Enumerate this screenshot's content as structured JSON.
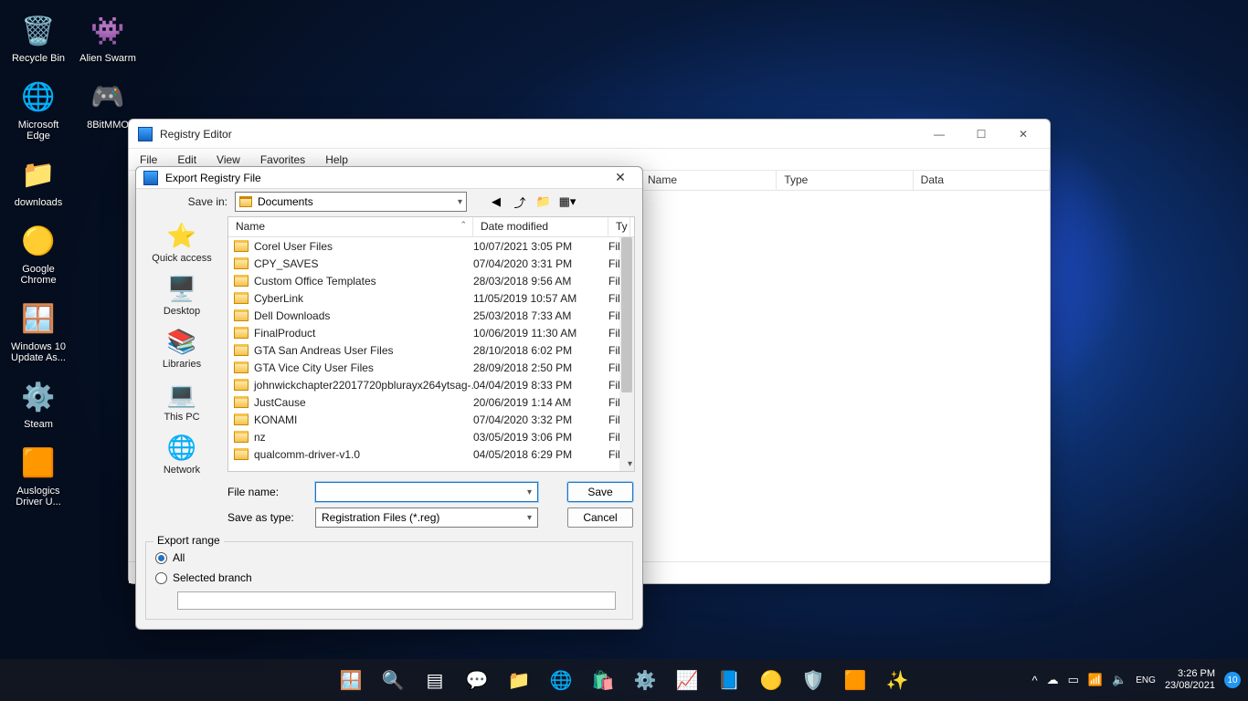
{
  "desktop_icons": [
    {
      "label": "Recycle Bin",
      "glyph": "🗑️"
    },
    {
      "label": "Alien Swarm",
      "glyph": "👾"
    },
    {
      "label": "Microsoft Edge",
      "glyph": "🌐"
    },
    {
      "label": "8BitMMO",
      "glyph": "🎮"
    },
    {
      "label": "downloads",
      "glyph": "📁"
    },
    {
      "label": "Google Chrome",
      "glyph": "🟡"
    },
    {
      "label": "Windows 10 Update As...",
      "glyph": "🪟"
    },
    {
      "label": "Steam",
      "glyph": "⚙️"
    },
    {
      "label": "Auslogics Driver U...",
      "glyph": "🟧"
    }
  ],
  "regedit": {
    "title": "Registry Editor",
    "menu": [
      "File",
      "Edit",
      "View",
      "Favorites",
      "Help"
    ],
    "right_cols": [
      "Name",
      "Type",
      "Data"
    ]
  },
  "dialog": {
    "title": "Export Registry File",
    "savein_label": "Save in:",
    "savein_value": "Documents",
    "places": [
      {
        "label": "Quick access",
        "glyph": "⭐"
      },
      {
        "label": "Desktop",
        "glyph": "🖥️"
      },
      {
        "label": "Libraries",
        "glyph": "📚"
      },
      {
        "label": "This PC",
        "glyph": "💻"
      },
      {
        "label": "Network",
        "glyph": "🌐"
      }
    ],
    "columns": {
      "name": "Name",
      "date": "Date modified",
      "type": "Ty"
    },
    "rows": [
      {
        "name": "Corel User Files",
        "date": "10/07/2021 3:05 PM",
        "type": "Fil"
      },
      {
        "name": "CPY_SAVES",
        "date": "07/04/2020 3:31 PM",
        "type": "Fil"
      },
      {
        "name": "Custom Office Templates",
        "date": "28/03/2018 9:56 AM",
        "type": "Fil"
      },
      {
        "name": "CyberLink",
        "date": "11/05/2019 10:57 AM",
        "type": "Fil"
      },
      {
        "name": "Dell Downloads",
        "date": "25/03/2018 7:33 AM",
        "type": "Fil"
      },
      {
        "name": "FinalProduct",
        "date": "10/06/2019 11:30 AM",
        "type": "Fil"
      },
      {
        "name": "GTA San Andreas User Files",
        "date": "28/10/2018 6:02 PM",
        "type": "Fil"
      },
      {
        "name": "GTA Vice City User Files",
        "date": "28/09/2018 2:50 PM",
        "type": "Fil"
      },
      {
        "name": "johnwickchapter22017720pblurayx264ytsag-...",
        "date": "04/04/2019 8:33 PM",
        "type": "Fil"
      },
      {
        "name": "JustCause",
        "date": "20/06/2019 1:14 AM",
        "type": "Fil"
      },
      {
        "name": "KONAMI",
        "date": "07/04/2020 3:32 PM",
        "type": "Fil"
      },
      {
        "name": "nz",
        "date": "03/05/2019 3:06 PM",
        "type": "Fil"
      },
      {
        "name": "qualcomm-driver-v1.0",
        "date": "04/05/2018 6:29 PM",
        "type": "Fil"
      }
    ],
    "filename_label": "File name:",
    "filename_value": "",
    "saveas_label": "Save as type:",
    "saveas_value": "Registration Files (*.reg)",
    "save_btn": "Save",
    "cancel_btn": "Cancel",
    "export_range": {
      "legend": "Export range",
      "all": "All",
      "selected": "Selected branch",
      "branch_value": ""
    }
  },
  "taskbar": {
    "items": [
      "start",
      "search",
      "taskview",
      "chat",
      "explorer",
      "edge",
      "store",
      "settings",
      "monitor",
      "word",
      "chrome",
      "security",
      "app1",
      "app2"
    ]
  },
  "tray": {
    "time": "3:26 PM",
    "date": "23/08/2021",
    "badge": "10"
  }
}
